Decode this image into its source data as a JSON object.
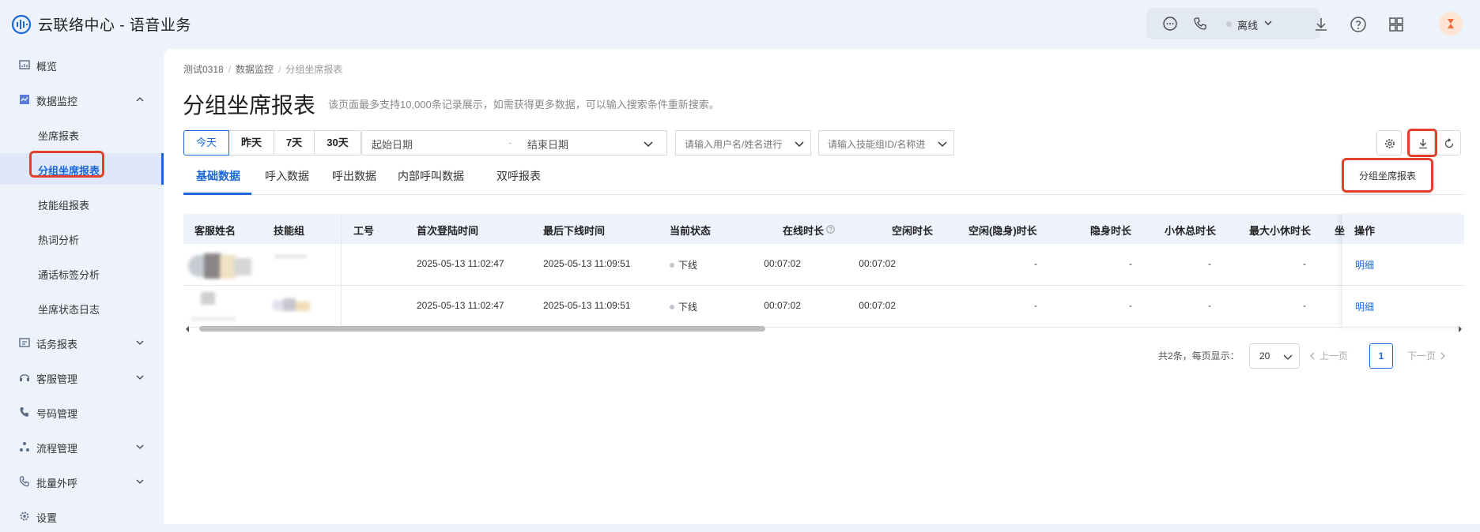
{
  "app": {
    "title": "云联络中心 - 语音业务"
  },
  "header": {
    "status_label": "离线"
  },
  "sidebar": {
    "items": [
      {
        "label": "概览"
      },
      {
        "label": "数据监控"
      },
      {
        "label": "坐席报表"
      },
      {
        "label": "分组坐席报表"
      },
      {
        "label": "技能组报表"
      },
      {
        "label": "热词分析"
      },
      {
        "label": "通话标签分析"
      },
      {
        "label": "坐席状态日志"
      },
      {
        "label": "话务报表"
      },
      {
        "label": "客服管理"
      },
      {
        "label": "号码管理"
      },
      {
        "label": "流程管理"
      },
      {
        "label": "批量外呼"
      },
      {
        "label": "设置"
      }
    ]
  },
  "breadcrumb": [
    "测试0318",
    "数据监控",
    "分组坐席报表"
  ],
  "page": {
    "title": "分组坐席报表",
    "description": "该页面最多支持10,000条记录展示，如需获得更多数据，可以输入搜索条件重新搜索。"
  },
  "filters": {
    "ranges": [
      "今天",
      "昨天",
      "7天",
      "30天"
    ],
    "start_date_placeholder": "起始日期",
    "date_separator": "-",
    "end_date_placeholder": "结束日期",
    "user_placeholder": "请输入用户名/姓名进行",
    "group_placeholder": "请输入技能组ID/名称进"
  },
  "export_menu": {
    "item": "分组坐席报表"
  },
  "tabs": [
    "基础数据",
    "呼入数据",
    "呼出数据",
    "内部呼叫数据",
    "双呼报表"
  ],
  "table": {
    "columns": [
      "客服姓名",
      "技能组",
      "工号",
      "首次登陆时间",
      "最后下线时间",
      "当前状态",
      "在线时长",
      "空闲时长",
      "空闲(隐身)时长",
      "隐身时长",
      "小休总时长",
      "最大小休时长",
      "坐",
      "操作"
    ],
    "rows": [
      {
        "first_login": "2025-05-13 11:02:47",
        "last_logout": "2025-05-13 11:09:51",
        "status": "下线",
        "online": "00:07:02",
        "idle": "00:07:02",
        "idle_hidden": "-",
        "hidden": "-",
        "break_total": "-",
        "break_max": "-",
        "action": "明细"
      },
      {
        "first_login": "2025-05-13 11:02:47",
        "last_logout": "2025-05-13 11:09:51",
        "status": "下线",
        "online": "00:07:02",
        "idle": "00:07:02",
        "idle_hidden": "-",
        "hidden": "-",
        "break_total": "-",
        "break_max": "-",
        "action": "明细"
      }
    ]
  },
  "pagination": {
    "total": "共2条，每页显示：",
    "page_size": "20",
    "prev": "上一页",
    "current": "1",
    "next": "下一页"
  },
  "colors": {
    "accent": "#1a67d9",
    "highlight": "#e0402c",
    "sidebar_bg": "#eef3fb"
  }
}
